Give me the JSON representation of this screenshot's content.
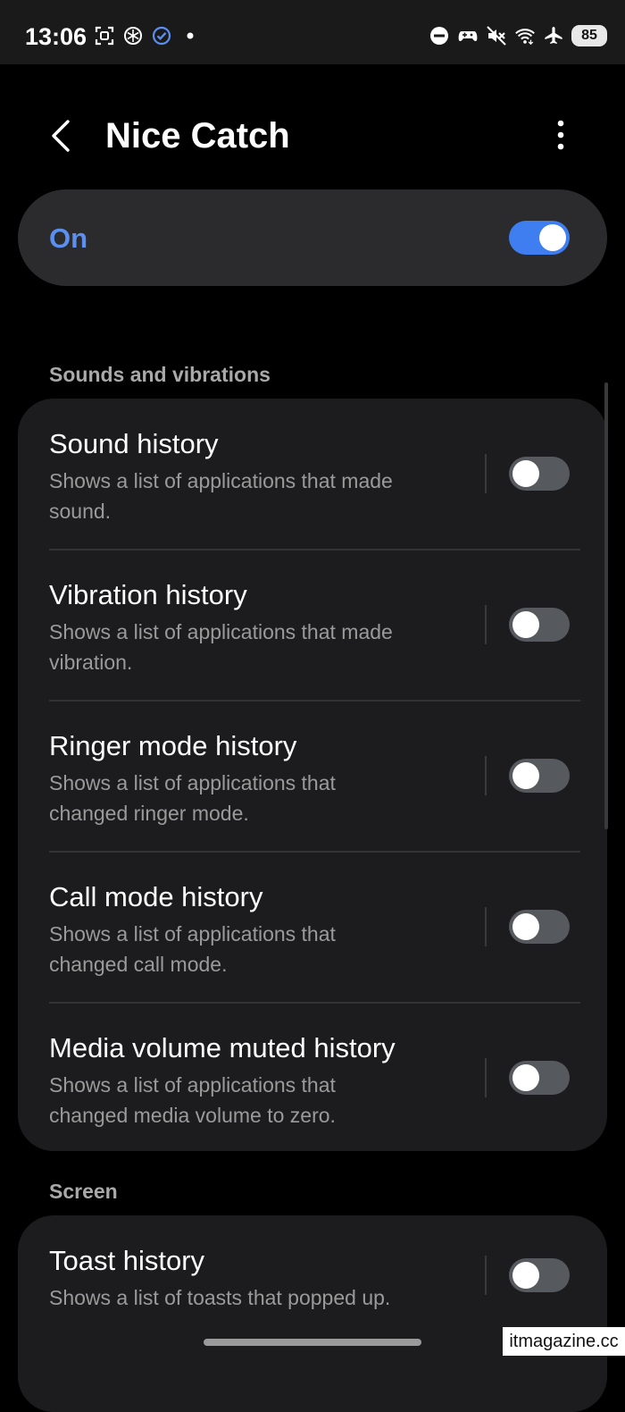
{
  "status_bar": {
    "time": "13:06",
    "battery": "85",
    "left_icons": [
      "screenshot-icon",
      "chatgpt-icon",
      "check-badge-icon",
      "dot-icon"
    ],
    "right_icons": [
      "dnd-icon",
      "gamepad-icon",
      "mute-icon",
      "wifi-icon",
      "airplane-icon"
    ]
  },
  "header": {
    "title": "Nice Catch",
    "back_icon": "chevron-left-icon",
    "more_icon": "more-vertical-icon"
  },
  "master_switch": {
    "label": "On",
    "on": true,
    "accent": "#3e7ef0",
    "label_color": "#5b8ff0"
  },
  "sections": [
    {
      "title": "Sounds and vibrations",
      "items": [
        {
          "title": "Sound history",
          "desc_line1": "Shows a list of applications that made",
          "desc_line2": "sound.",
          "on": false
        },
        {
          "title": "Vibration history",
          "desc_line1": "Shows a list of applications that made",
          "desc_line2": "vibration.",
          "on": false
        },
        {
          "title": "Ringer mode history",
          "desc_line1": "Shows a list of applications that",
          "desc_line2": "changed ringer mode.",
          "on": false
        },
        {
          "title": "Call mode history",
          "desc_line1": "Shows a list of applications that",
          "desc_line2": "changed call mode.",
          "on": false
        },
        {
          "title": "Media volume muted history",
          "desc_line1": "Shows a list of applications that",
          "desc_line2": "changed media volume to zero.",
          "on": false
        }
      ]
    },
    {
      "title": "Screen",
      "items": [
        {
          "title": "Toast history",
          "desc_line1": "Shows a list of toasts that popped up.",
          "on": false
        }
      ]
    }
  ],
  "watermark": "itmagazine.cc"
}
